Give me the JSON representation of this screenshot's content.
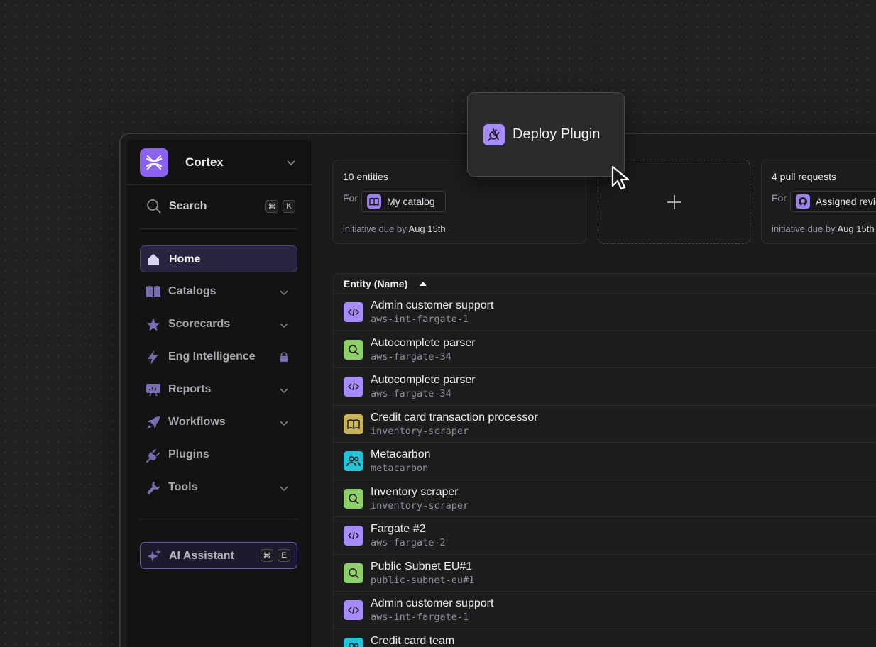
{
  "colors": {
    "accent": "#8b62f0",
    "purple": "#a78bfa",
    "green": "#8fcf6a",
    "yellow": "#c9b35b",
    "cyan": "#22c3d6"
  },
  "sidebar": {
    "workspace": "Cortex",
    "search": {
      "label": "Search",
      "keys": [
        "⌘",
        "K"
      ]
    },
    "nav": [
      {
        "label": "Home",
        "icon": "home-icon"
      },
      {
        "label": "Catalogs",
        "icon": "book-icon"
      },
      {
        "label": "Scorecards",
        "icon": "star-icon"
      },
      {
        "label": "Eng Intelligence",
        "icon": "bolt-icon"
      },
      {
        "label": "Reports",
        "icon": "presentation-icon"
      },
      {
        "label": "Workflows",
        "icon": "rocket-icon"
      },
      {
        "label": "Plugins",
        "icon": "plug-icon"
      },
      {
        "label": "Tools",
        "icon": "wrench-icon"
      }
    ],
    "ai": {
      "label": "AI Assistant",
      "keys": [
        "⌘",
        "E"
      ]
    }
  },
  "cards": [
    {
      "title": "10 entities",
      "for": "For",
      "chip": "My catalog",
      "due_prefix": "initiative due by",
      "due_date": "Aug 15th"
    },
    {
      "title": "4 pull requests",
      "for": "For",
      "chip": "Assigned reviews",
      "due_prefix": "initiative due by",
      "due_date": "Aug 15th"
    }
  ],
  "tooltip": {
    "label": "Deploy Plugin"
  },
  "table": {
    "header": "Entity (Name)",
    "rows": [
      {
        "name": "Admin customer support",
        "tag": "aws-int-fargate-1"
      },
      {
        "name": "Autocomplete parser",
        "tag": "aws-fargate-34"
      },
      {
        "name": "Autocomplete parser",
        "tag": "aws-fargate-34"
      },
      {
        "name": "Credit card transaction processor",
        "tag": "inventory-scraper"
      },
      {
        "name": "Metacarbon",
        "tag": "metacarbon"
      },
      {
        "name": "Inventory scraper",
        "tag": "inventory-scraper"
      },
      {
        "name": "Fargate #2",
        "tag": "aws-fargate-2"
      },
      {
        "name": "Public Subnet EU#1",
        "tag": "public-subnet-eu#1"
      },
      {
        "name": "Admin customer support",
        "tag": "aws-int-fargate-1"
      },
      {
        "name": "Credit card team",
        "tag": ""
      }
    ]
  }
}
